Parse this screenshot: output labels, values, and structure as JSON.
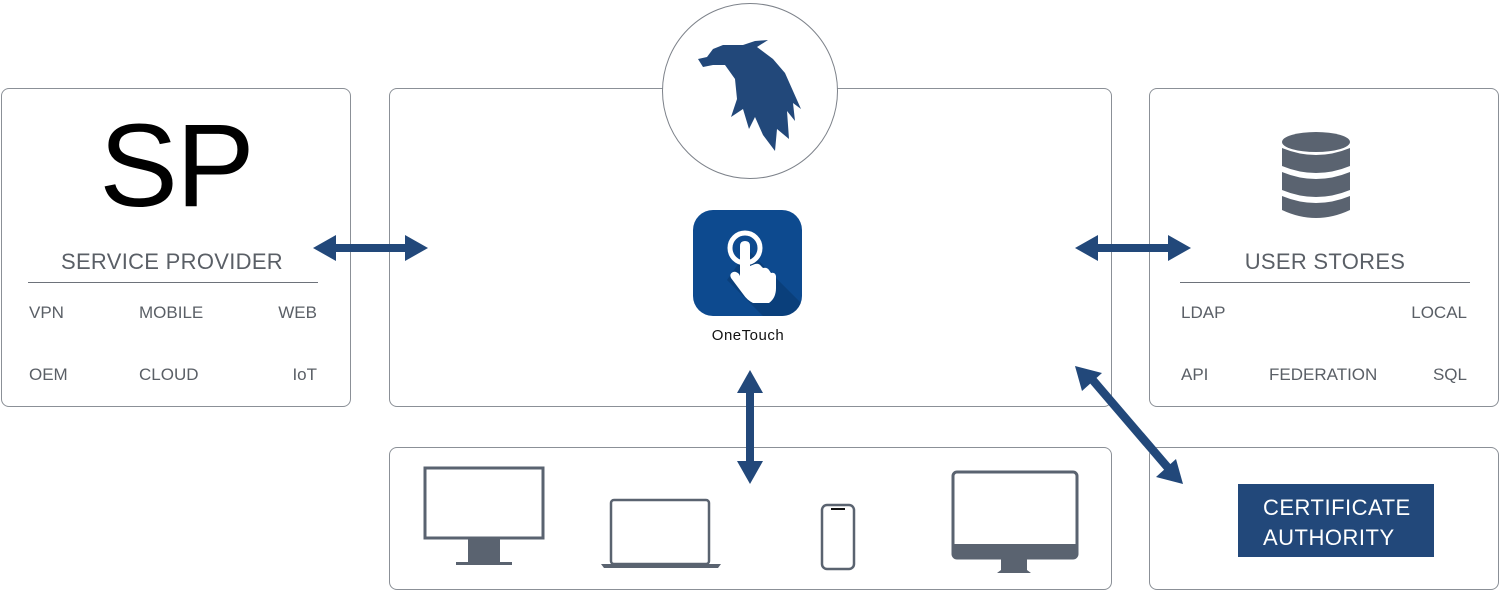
{
  "colors": {
    "accent": "#22487a",
    "icon_gray": "#5a6370",
    "border": "#8b9097",
    "onetouch_bg": "#0d4a8f"
  },
  "service_provider": {
    "abbr": "SP",
    "title": "SERVICE PROVIDER",
    "items": [
      "VPN",
      "MOBILE",
      "WEB",
      "OEM",
      "CLOUD",
      "IoT"
    ]
  },
  "core": {
    "logo_icon": "eagle-logo-icon",
    "app_icon": "touch-hand-icon",
    "app_label": "OneTouch"
  },
  "user_stores": {
    "icon": "database-icon",
    "title": "USER STORES",
    "items": [
      "LDAP",
      "LOCAL",
      "API",
      "FEDERATION",
      "SQL"
    ]
  },
  "devices": {
    "items": [
      "desktop-monitor-icon",
      "laptop-icon",
      "smartphone-icon",
      "imac-icon"
    ]
  },
  "certificate_authority": {
    "line1": "CERTIFICATE",
    "line2": "AUTHORITY"
  },
  "connections": [
    {
      "from": "service-provider",
      "to": "core",
      "type": "bidirectional"
    },
    {
      "from": "core",
      "to": "user-stores",
      "type": "bidirectional"
    },
    {
      "from": "core",
      "to": "devices",
      "type": "bidirectional"
    },
    {
      "from": "core",
      "to": "certificate-authority",
      "type": "bidirectional"
    }
  ]
}
